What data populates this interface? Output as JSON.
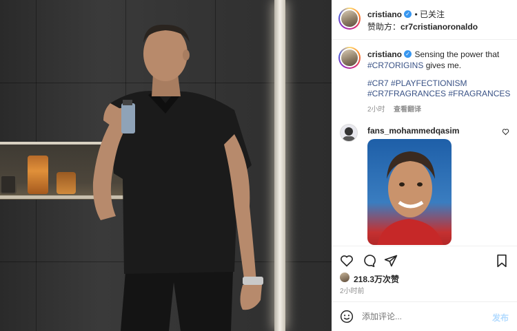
{
  "post": {
    "author": "cristiano",
    "follow_status": "已关注",
    "sponsor_label": "赞助方：",
    "sponsor_name": "cr7cristianoronaldo",
    "caption_text": "Sensing the power that",
    "caption_tag_inline": "#CR7ORIGINS",
    "caption_tail": " gives me.",
    "tags_line1": "#CR7 #PLAYFECTIONISM",
    "tags_line2": "#CR7FRAGRANCES #FRAGRANCES",
    "caption_time": "2小时",
    "see_translation": "查看翻译"
  },
  "comment": {
    "author": "fans_mohammedqasim"
  },
  "actions": {
    "likes": "218.3万次赞",
    "time": "2小时前"
  },
  "composer": {
    "placeholder": "添加评论...",
    "post_label": "发布"
  }
}
